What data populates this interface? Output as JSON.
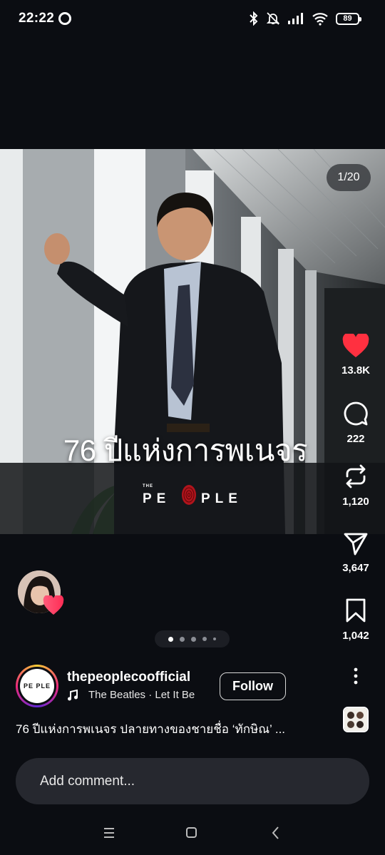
{
  "status_bar": {
    "time": "22:22",
    "battery": "89",
    "icons": [
      "record-icon",
      "bluetooth-icon",
      "mute-icon",
      "signal-icon",
      "wifi-icon",
      "battery-icon"
    ]
  },
  "post": {
    "counter": "1/20",
    "headline": "76 ปีแห่งการพเนจร",
    "brand_small": "THE",
    "brand_left": "PE",
    "brand_right": "PLE"
  },
  "actions": {
    "likes": "13.8K",
    "comments": "222",
    "reposts": "1,120",
    "shares": "3,647",
    "saves": "1,042"
  },
  "author": {
    "username": "thepeoplecoofficial",
    "avatar_text": "PE PLE",
    "music": "The Beatles · Let It Be",
    "follow_label": "Follow"
  },
  "caption": "76 ปีแห่งการพเนจร ปลายทางของชายชื่อ ‘ทักษิณ’ ...",
  "comment": {
    "placeholder": "Add comment..."
  },
  "colors": {
    "background": "#0b0d12",
    "like_red": "#ff3040",
    "comment_bg": "#26282f"
  }
}
